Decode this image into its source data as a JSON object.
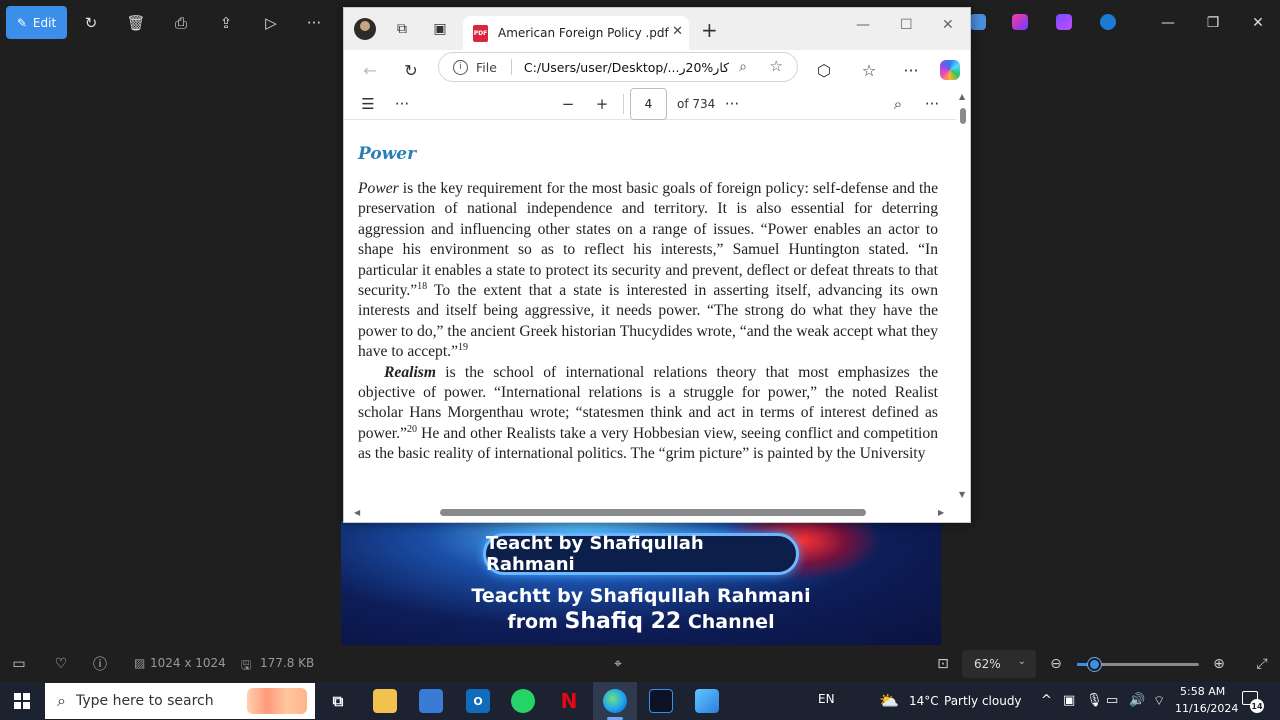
{
  "photos": {
    "toolbar": {
      "edit_label": "Edit",
      "icons": [
        "rotate-icon",
        "delete-icon",
        "print-icon",
        "share-icon",
        "slideshow-icon",
        "more-icon"
      ]
    },
    "bottom": {
      "dimensions": "1024 x 1024",
      "file_size": "177.8 KB",
      "zoom": "62%",
      "zoom_fraction": 0.14
    }
  },
  "banner": {
    "pill_text": "Teacht by Shafiqullah Rahmani",
    "line1": "Teachtt by Shafiqullah Rahmani",
    "line2_prefix": "from ",
    "line2_name": "Shafiq 22",
    "line2_suffix": " Channel"
  },
  "edge": {
    "tab_title": "American Foreign Policy .pdf",
    "tab_badge": "PDF",
    "url_label": "File",
    "url_path": "C:/Users/user/Desktop/...کار%20ر",
    "pdf": {
      "page_current": "4",
      "page_total": "of 734"
    },
    "document": {
      "heading": "Power",
      "p1_lead": "Power",
      "p1_text": " is the key requirement for the most basic goals of foreign policy: self-defense and the preservation of national independence and territory. It is also essential for deterring aggression and influencing other states on a range of issues. “Power enables an actor to shape his environment so as to reflect his interests,” Samuel Huntington stated. “In particular it enables a state to protect its security and prevent, deflect or defeat threats to that security.”",
      "p1_sup1": "18",
      "p1_text2": " To the extent that a state is interested in asserting itself, advancing its own interests and itself being aggressive, it needs power. “The strong do what they have the power to do,” the ancient Greek historian Thucydides wrote, “and the weak accept what they have to accept.”",
      "p1_sup2": "19",
      "p2_lead": "Realism",
      "p2_text": " is the school of international relations theory that most emphasizes the objective of power. “International relations is a struggle for power,” the noted Realist scholar Hans Morgenthau wrote; “statesmen think and act in terms of interest defined as power.”",
      "p2_sup": "20",
      "p2_text2": " He and other Realists take a very Hobbesian view, seeing conflict and competition as the basic reality of international politics. The “grim picture” is painted by the University"
    }
  },
  "taskbar": {
    "search_placeholder": "Type here to search",
    "lang": "EN",
    "weather_temp": "14°C",
    "weather_desc": "Partly cloudy",
    "time": "5:58 AM",
    "date": "11/16/2024",
    "notification_count": "14"
  },
  "colors": {
    "accent": "#3b8eea",
    "heading_blue": "#2a7fb5",
    "taskbar": "#1c2230"
  }
}
